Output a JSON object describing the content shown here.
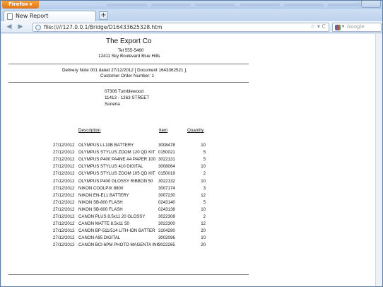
{
  "browser": {
    "menu_label": "Firefox",
    "tab_title": "New Report",
    "new_tab": "+",
    "url": "file://///127.0.0.1/Bridge/D16433625328.htm",
    "search_placeholder": "Google"
  },
  "document": {
    "company": "The Export Co",
    "tel": "Tel 555-5460",
    "address": "12411 Sky Boulevard Blue Hills",
    "delivery_note": "Delivery Note 001 dated 27/12/2012 [ Document 1643362521 ].",
    "customer_order": "Customer Order Number: 1",
    "ship_to": [
      "07306 Tumblewood",
      "11413 - 1263 STREET",
      "Suneria"
    ],
    "headers": {
      "description": "Description",
      "item": "Item",
      "quantity": "Quantity"
    },
    "lines": [
      {
        "date": "27/12/2012",
        "description": "OLYMPUS LI-10B BATTERY",
        "item": "3008478",
        "qty": "10"
      },
      {
        "date": "27/12/2012",
        "description": "OLYMPUS STYLUS ZOOM 120 QD KIT",
        "item": "0150021",
        "qty": "5"
      },
      {
        "date": "27/12/2012",
        "description": "OLYMPUS P400 PA4NE A4 PAPER 100",
        "item": "3022131",
        "qty": "5"
      },
      {
        "date": "27/12/2012",
        "description": "OLYMPUS STYLUS 410 DIGITAL",
        "item": "3008064",
        "qty": "10"
      },
      {
        "date": "27/12/2012",
        "description": "OLYMPUS STYLUS ZOOM 105 QD KIT",
        "item": "0150019",
        "qty": "2"
      },
      {
        "date": "27/12/2012",
        "description": "OLYMPUS P400 GLOSSY RIBBON 50",
        "item": "3022132",
        "qty": "10"
      },
      {
        "date": "27/12/2012",
        "description": "NIKON COOLPIX 8800",
        "item": "3007174",
        "qty": "3"
      },
      {
        "date": "27/12/2012",
        "description": "NIKON EN-EL1 BATTERY",
        "item": "3007230",
        "qty": "12"
      },
      {
        "date": "27/12/2012",
        "description": "NIKON SB-800 FLASH",
        "item": "0243140",
        "qty": "5"
      },
      {
        "date": "27/12/2012",
        "description": "NIKON SB-600 FLASH",
        "item": "0243138",
        "qty": "10"
      },
      {
        "date": "27/12/2012",
        "description": "CANON PLUS 8.5x11 20 GLOSSY",
        "item": "3022308",
        "qty": "2"
      },
      {
        "date": "27/12/2012",
        "description": "CANON MATTE 8.5x11 50",
        "item": "3022300",
        "qty": "12"
      },
      {
        "date": "27/12/2012",
        "description": "CANON BP-511/514 LITH-ION BATTER",
        "item": "3104290",
        "qty": "20"
      },
      {
        "date": "27/12/2012",
        "description": "CANON A95 DIGITAL",
        "item": "3002096",
        "qty": "10"
      },
      {
        "date": "27/12/2012",
        "description": "CANON BCI-6PM PHOTO MAGENTA INK",
        "item": "3022265",
        "qty": "20"
      }
    ]
  }
}
